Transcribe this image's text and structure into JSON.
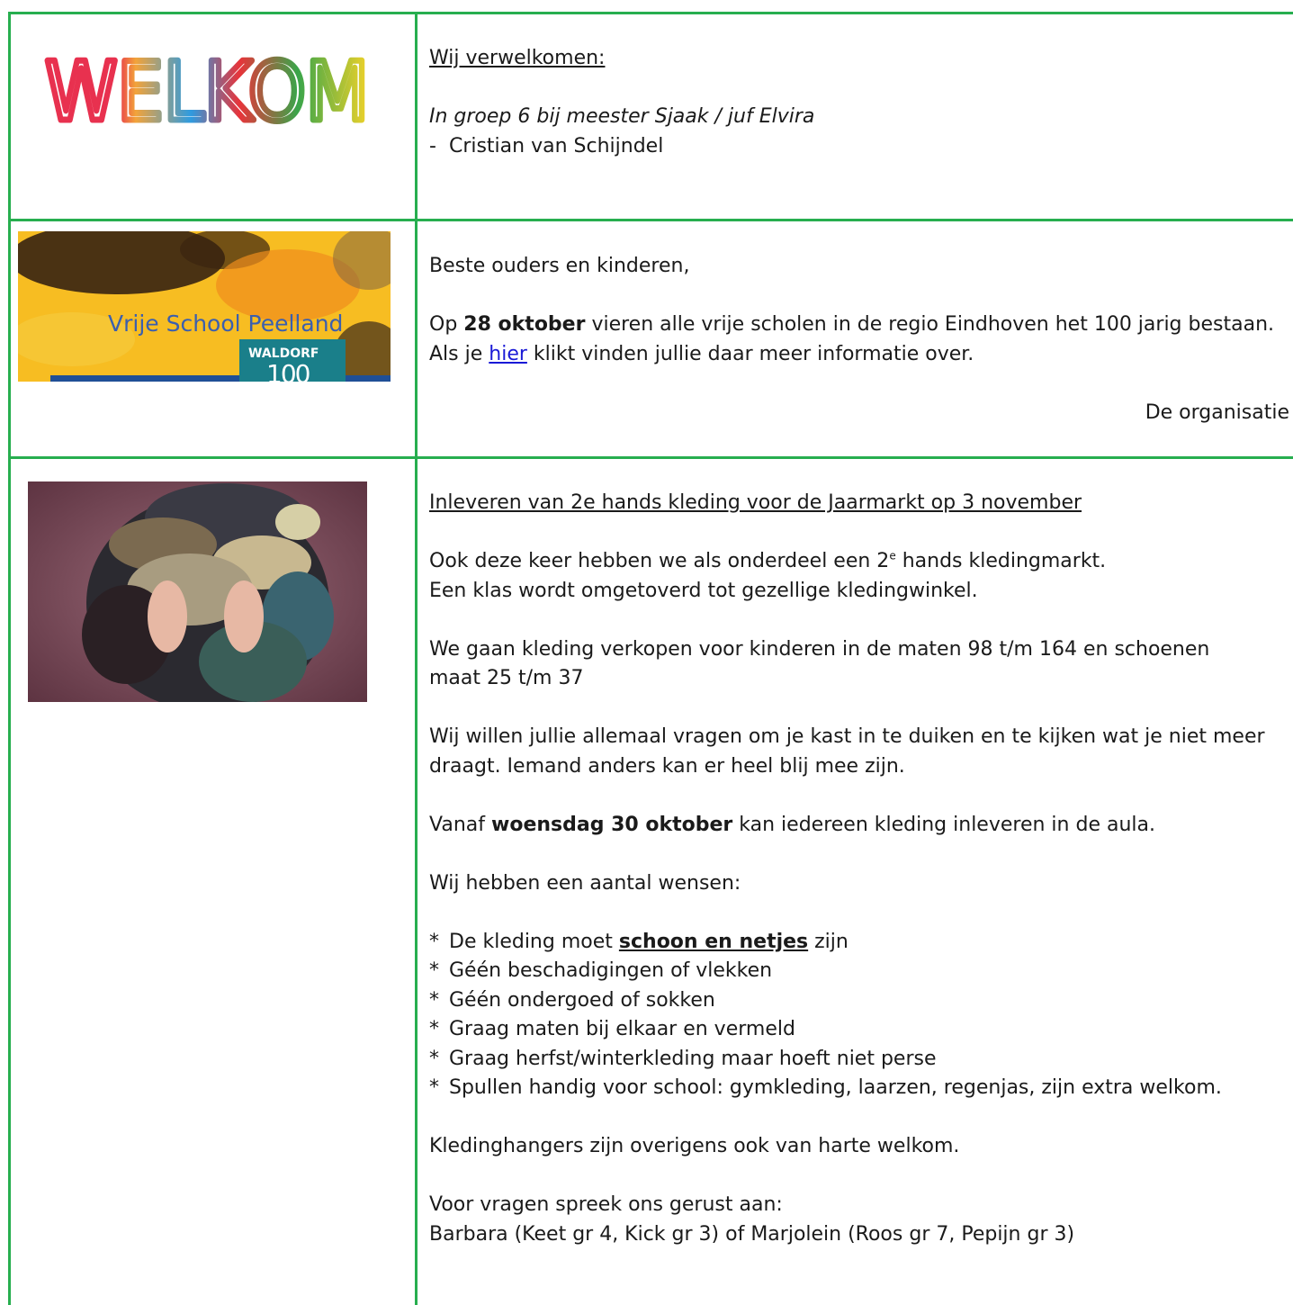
{
  "welcome": {
    "logo_text": "WELKOM",
    "heading": "Wij verwelkomen:",
    "group_line": "In groep 6 bij meester Sjaak / juf Elvira",
    "dash": "-",
    "name": "Cristian van Schijndel"
  },
  "anniversary": {
    "image": {
      "school_name": "Vrije School Peelland",
      "badge_top": "WALDORF",
      "badge_bottom": "100"
    },
    "greeting": "Beste ouders en kinderen,",
    "line1_pre": "Op ",
    "line1_bold": "28 oktober",
    "line1_post": " vieren alle vrije scholen in de regio Eindhoven het 100 jarig bestaan.",
    "line2_pre": "Als je ",
    "line2_link": "hier",
    "line2_post": " klikt vinden jullie daar meer informatie over.",
    "signature": "De organisatie"
  },
  "clothing": {
    "image_alt": "stapel kleding",
    "heading": "Inleveren van 2e hands kleding voor de Jaarmarkt op 3 november",
    "p1_pre": "Ook deze keer hebben we als onderdeel een 2",
    "p1_sup": "e",
    "p1_post": " hands kledingmarkt.",
    "p1_line2": "Een klas wordt omgetoverd tot gezellige kledingwinkel.",
    "p2_line1": "We gaan kleding verkopen voor kinderen in de maten 98 t/m 164 en schoenen",
    "p2_line2": "maat 25 t/m 37",
    "p3_line1": "Wij willen jullie allemaal vragen om je kast in te duiken en te kijken wat je niet meer",
    "p3_line2": "draagt. Iemand anders kan er heel blij mee zijn.",
    "p4_pre": "Vanaf ",
    "p4_bold": "woensdag 30 oktober",
    "p4_post": " kan iedereen kleding inleveren in de aula.",
    "wishes_intro": "Wij hebben een aantal wensen:",
    "bullet_char": "*",
    "bullet1_pre": "De kleding moet ",
    "bullet1_bold": "schoon en netjes",
    "bullet1_post": " zijn",
    "bullets": [
      "Géén beschadigingen of vlekken",
      "Géén ondergoed of sokken",
      "Graag maten bij elkaar en vermeld",
      "Graag herfst/winterkleding maar hoeft niet perse",
      "Spullen handig voor school: gymkleding, laarzen, regenjas, zijn extra welkom."
    ],
    "hangers": "Kledinghangers zijn overigens ook van harte welkom.",
    "contact_intro": "Voor vragen spreek ons gerust aan:",
    "contact_names": "Barbara (Keet gr 4, Kick gr 3) of Marjolein (Roos gr 7, Pepijn gr 3)"
  },
  "colors": {
    "border": "#27ae4f",
    "link": "#1a1ad6"
  }
}
